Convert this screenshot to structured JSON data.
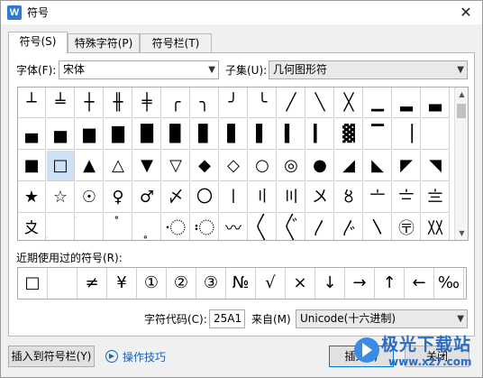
{
  "window": {
    "app_icon": "W",
    "title": "符号",
    "close_glyph": "✕"
  },
  "tabs": [
    {
      "label": "符号(S)"
    },
    {
      "label": "特殊字符(P)"
    },
    {
      "label": "符号栏(T)"
    }
  ],
  "font_label": "字体(F):",
  "font_value": "宋体",
  "subset_label": "子集(U):",
  "subset_value": "几何图形符",
  "symbol_grid": [
    [
      "┴",
      "╧",
      "┼",
      "╫",
      "╪",
      "╭",
      "╮",
      "╯",
      "╰",
      "╱",
      "╲",
      "╳",
      "▁",
      "▂",
      "▃"
    ],
    [
      "▄",
      "▅",
      "▆",
      "▇",
      "█",
      "▉",
      "▊",
      "▋",
      "▌",
      "▍",
      "▎",
      "▓",
      "▔",
      "▕",
      ""
    ],
    [
      "■",
      "□",
      "▲",
      "△",
      "▼",
      "▽",
      "◆",
      "◇",
      "○",
      "◎",
      "●",
      "◢",
      "◣",
      "◤",
      "◥"
    ],
    [
      "★",
      "☆",
      "☉",
      "♀",
      "♂",
      "〆",
      "〇",
      "〡",
      "〢",
      "〣",
      "〤",
      "〥",
      "〦",
      "〧",
      "〨"
    ],
    [
      "〩",
      "〪",
      "〫",
      "〬",
      "〭",
      "〮",
      "〯",
      "〰",
      "〱",
      "〲",
      "〳",
      "〴",
      "〵",
      "〶",
      "〷"
    ]
  ],
  "selected_symbol": "□",
  "recent_label": "近期使用过的符号(R):",
  "recent_symbols": [
    "□",
    "",
    "≠",
    "¥",
    "①",
    "②",
    "③",
    "№",
    "√",
    "×",
    "↓",
    "→",
    "↑",
    "←",
    "‰"
  ],
  "char_code_label": "字符代码(C):",
  "char_code_value": "25A1",
  "from_label": "来自(M)",
  "from_value": "Unicode(十六进制)",
  "buttons": {
    "insert_to_bar": "插入到符号栏(Y)",
    "tips": "操作技巧",
    "insert": "插入(I)",
    "close": "关闭"
  },
  "watermark": {
    "main": "极光下载站",
    "sub": "www.xz7.com"
  }
}
